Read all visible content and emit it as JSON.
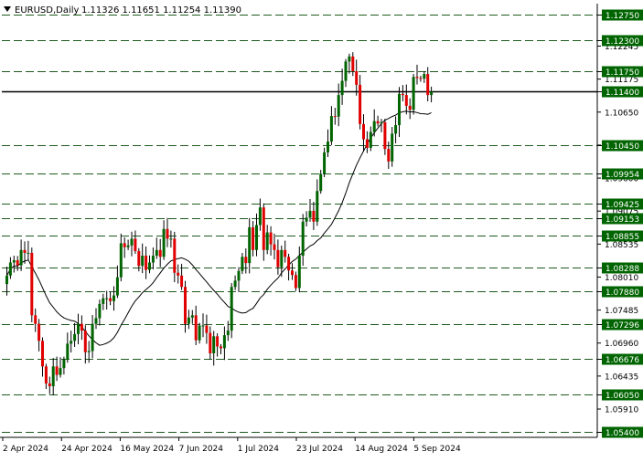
{
  "header": {
    "symbol": "EURUSD,Daily",
    "ohlc": "1.11326 1.11651 1.11254 1.11390"
  },
  "colors": {
    "bull": "#006400",
    "bear": "#e00000",
    "wick": "#000000",
    "ma": "#000000",
    "level_line": "#1e5a1e",
    "level_tag_bg": "#006400",
    "level_tag_text": "#ffffff",
    "frame": "#000000",
    "background": "#ffffff"
  },
  "chart_data": {
    "type": "candlestick",
    "title": "EURUSD,Daily",
    "ylim": [
      1.053,
      1.1294
    ],
    "grid": false,
    "price_scale_labels": [
      "1.12245",
      "1.11175",
      "1.10650",
      "1.10125",
      "1.09600",
      "1.09075",
      "1.08535",
      "1.08010",
      "1.07485",
      "1.06960",
      "1.06435",
      "1.05910"
    ],
    "x_tick_labels": [
      "2 Apr 2024",
      "24 Apr 2024",
      "16 May 2024",
      "7 Jun 2024",
      "1 Jul 2024",
      "23 Jul 2024",
      "14 Aug 2024",
      "5 Sep 2024"
    ],
    "levels": [
      {
        "label": "1.12750",
        "value": 1.1275,
        "bold": false
      },
      {
        "label": "1.12300",
        "value": 1.123,
        "bold": false
      },
      {
        "label": "1.11750",
        "value": 1.1175,
        "bold": false
      },
      {
        "label": "1.11400",
        "value": 1.114,
        "bold": true
      },
      {
        "label": "1.10450",
        "value": 1.1045,
        "bold": false
      },
      {
        "label": "1.09954",
        "value": 1.09954,
        "bold": false
      },
      {
        "label": "1.09425",
        "value": 1.09425,
        "bold": false
      },
      {
        "label": "1.09153",
        "value": 1.09153,
        "bold": false
      },
      {
        "label": "1.08855",
        "value": 1.08855,
        "bold": false
      },
      {
        "label": "1.08288",
        "value": 1.08288,
        "bold": false
      },
      {
        "label": "1.07880",
        "value": 1.0788,
        "bold": false
      },
      {
        "label": "1.07296",
        "value": 1.07296,
        "bold": false
      },
      {
        "label": "1.06676",
        "value": 1.06676,
        "bold": false
      },
      {
        "label": "1.06050",
        "value": 1.0605,
        "bold": false
      },
      {
        "label": "1.05400",
        "value": 1.054,
        "bold": false
      }
    ],
    "closes": [
      1.0815,
      1.0838,
      1.0842,
      1.0833,
      1.086,
      1.0855,
      1.0855,
      1.0745,
      1.073,
      1.07,
      1.0655,
      1.0625,
      1.062,
      1.0655,
      1.064,
      1.0652,
      1.0667,
      1.0695,
      1.07,
      1.0712,
      1.073,
      1.0718,
      1.068,
      1.0682,
      1.073,
      1.074,
      1.0765,
      1.0775,
      1.0775,
      1.077,
      1.078,
      1.0812,
      1.0872,
      1.0865,
      1.0868,
      1.088,
      1.0858,
      1.0832,
      1.085,
      1.0825,
      1.0838,
      1.085,
      1.086,
      1.0848,
      1.0897,
      1.088,
      1.088,
      1.082,
      1.0815,
      1.0795,
      1.073,
      1.0741,
      1.0745,
      1.0701,
      1.0727,
      1.0727,
      1.0714,
      1.0678,
      1.0708,
      1.069,
      1.0687,
      1.071,
      1.0718,
      1.0795,
      1.0806,
      1.0823,
      1.0848,
      1.0837,
      1.09,
      1.086,
      1.0904,
      1.0935,
      1.086,
      1.0891,
      1.087,
      1.086,
      1.083,
      1.086,
      1.0848,
      1.0824,
      1.0816,
      1.0793,
      1.085,
      1.091,
      1.0917,
      1.0929,
      1.091,
      1.0964,
      1.0994,
      1.1032,
      1.1051,
      1.1096,
      1.1095,
      1.1133,
      1.1158,
      1.1192,
      1.1201,
      1.1175,
      1.1151,
      1.1082,
      1.1055,
      1.104,
      1.1068,
      1.1087,
      1.1083,
      1.1085,
      1.1038,
      1.1016,
      1.1065,
      1.108,
      1.1135,
      1.1133,
      1.1114,
      1.1107,
      1.1165,
      1.1163,
      1.1162,
      1.117,
      1.1133,
      1.1139
    ],
    "series": [
      {
        "type": "candlestick",
        "values": "closes"
      },
      {
        "type": "line",
        "values": "moving average of closes (20)"
      }
    ]
  }
}
